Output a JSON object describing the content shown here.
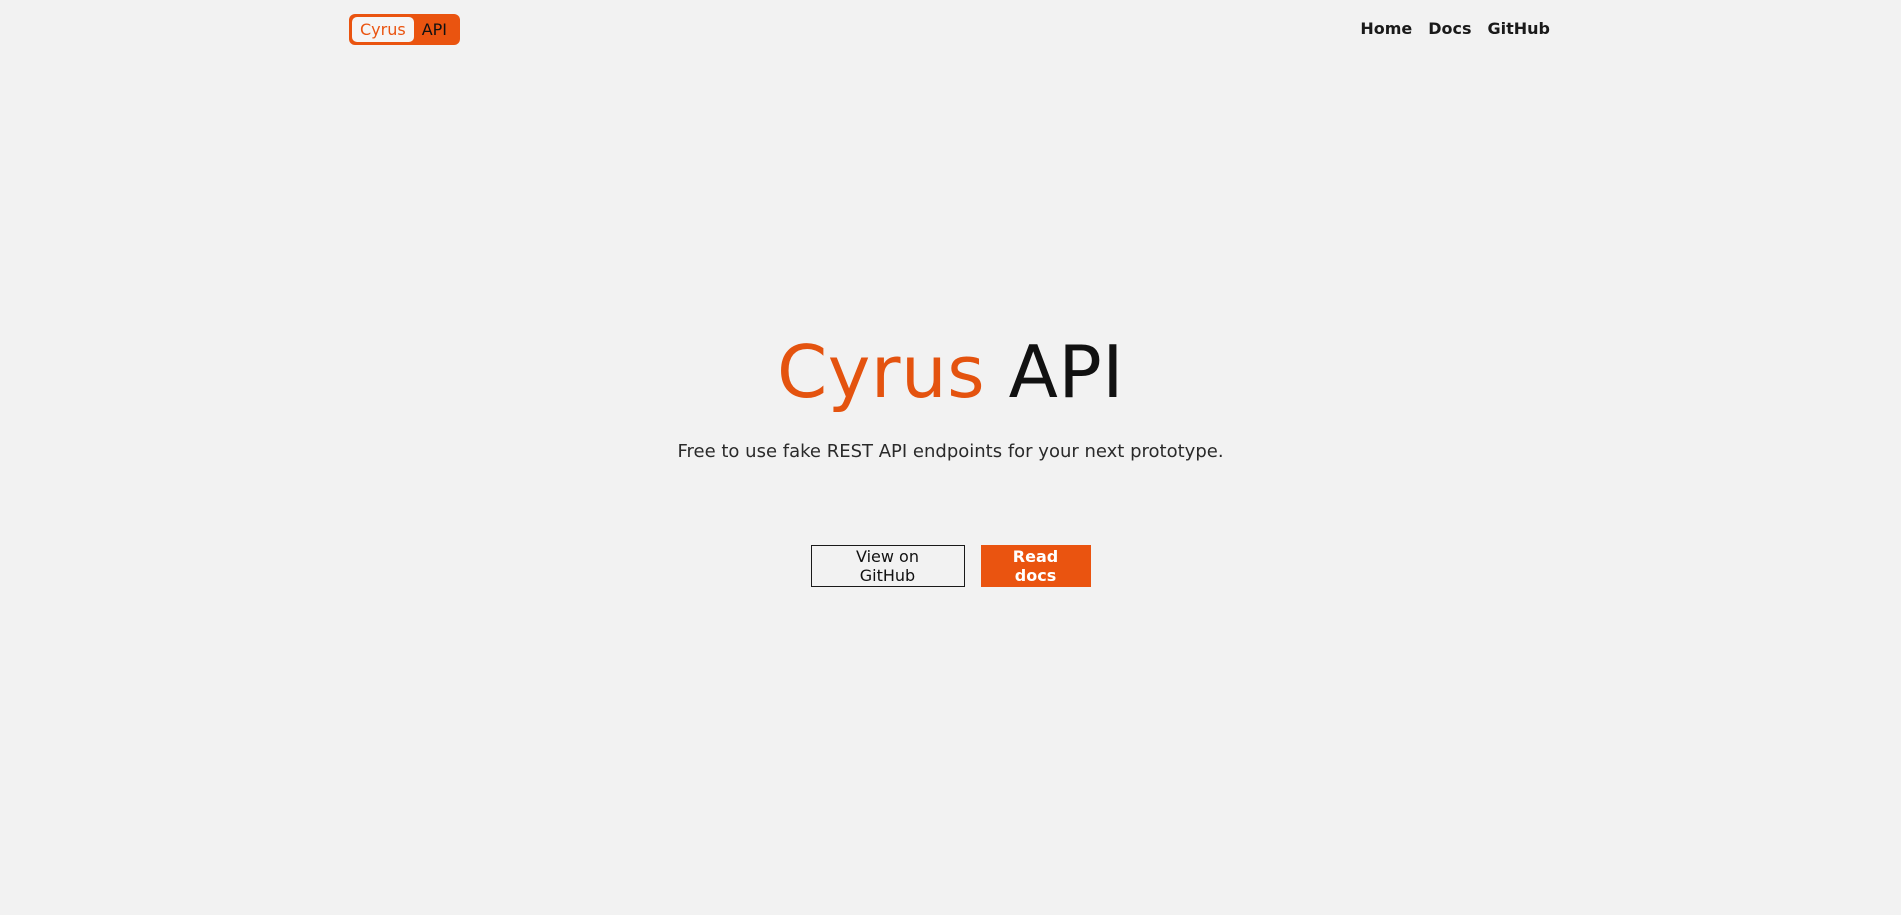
{
  "header": {
    "logo": {
      "word": "Cyrus",
      "suffix": "API"
    },
    "nav": [
      {
        "label": "Home"
      },
      {
        "label": "Docs"
      },
      {
        "label": "GitHub"
      }
    ]
  },
  "hero": {
    "title_accent": "Cyrus",
    "title_rest": "API",
    "subtitle": "Free to use fake REST API endpoints for your next prototype.",
    "buttons": {
      "github": "View on GitHub",
      "docs": "Read docs"
    }
  },
  "colors": {
    "accent": "#ea5410",
    "background": "#f2f2f2",
    "text": "#111111"
  }
}
